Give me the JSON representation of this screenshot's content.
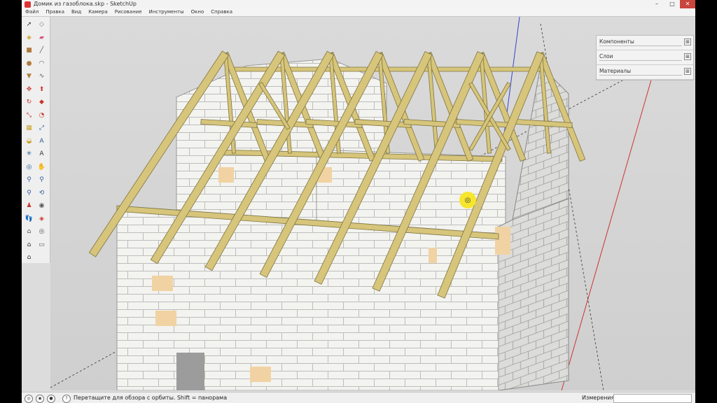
{
  "window": {
    "title": "Домик из газоблока.skp - SketchUp",
    "minimize": "–",
    "maximize": "□",
    "close": "✕"
  },
  "menu": [
    "Файл",
    "Правка",
    "Вид",
    "Камера",
    "Рисование",
    "Инструменты",
    "Окно",
    "Справка"
  ],
  "toolbar": {
    "tools": [
      {
        "name": "select-icon",
        "glyph": "➚",
        "color": "#333333"
      },
      {
        "name": "eraser-icon",
        "glyph": "◇",
        "color": "#777777"
      },
      {
        "name": "paint-bucket-icon",
        "glyph": "◈",
        "color": "#c9a227"
      },
      {
        "name": "eraser-pink-icon",
        "glyph": "▰",
        "color": "#d85a8a"
      },
      {
        "name": "rectangle-icon",
        "glyph": "■",
        "color": "#b07b3e"
      },
      {
        "name": "pencil-icon",
        "glyph": "╱",
        "color": "#555555"
      },
      {
        "name": "circle-icon",
        "glyph": "●",
        "color": "#b07b3e"
      },
      {
        "name": "arc-icon",
        "glyph": "◠",
        "color": "#555555"
      },
      {
        "name": "polygon-icon",
        "glyph": "▼",
        "color": "#b07b3e"
      },
      {
        "name": "freehand-icon",
        "glyph": "∿",
        "color": "#555555"
      },
      {
        "name": "move-icon",
        "glyph": "✥",
        "color": "#c8372d"
      },
      {
        "name": "push-pull-icon",
        "glyph": "⬆",
        "color": "#c8372d"
      },
      {
        "name": "rotate-icon",
        "glyph": "↻",
        "color": "#c8372d"
      },
      {
        "name": "follow-me-icon",
        "glyph": "◆",
        "color": "#c8372d"
      },
      {
        "name": "scale-icon",
        "glyph": "⤡",
        "color": "#c8372d"
      },
      {
        "name": "offset-icon",
        "glyph": "◔",
        "color": "#c8372d"
      },
      {
        "name": "tape-measure-icon",
        "glyph": "▦",
        "color": "#c9a227"
      },
      {
        "name": "dimension-icon",
        "glyph": "⤢",
        "color": "#2e5c99"
      },
      {
        "name": "protractor-icon",
        "glyph": "◒",
        "color": "#c9a227"
      },
      {
        "name": "text-icon",
        "glyph": "A",
        "color": "#2e5c99"
      },
      {
        "name": "axes-icon",
        "glyph": "✳",
        "color": "#2e5c99"
      },
      {
        "name": "3d-text-icon",
        "glyph": "A",
        "color": "#333333"
      },
      {
        "name": "orbit-icon",
        "glyph": "◎",
        "color": "#2e5c99"
      },
      {
        "name": "pan-icon",
        "glyph": "✋",
        "color": "#2e5c99"
      },
      {
        "name": "zoom-icon",
        "glyph": "⚲",
        "color": "#2e5c99"
      },
      {
        "name": "zoom-window-icon",
        "glyph": "⚲",
        "color": "#2e5c99"
      },
      {
        "name": "zoom-extents-icon",
        "glyph": "⚲",
        "color": "#2e5c99"
      },
      {
        "name": "previous-view-icon",
        "glyph": "⟲",
        "color": "#2e5c99"
      },
      {
        "name": "position-camera-icon",
        "glyph": "♟",
        "color": "#c8372d"
      },
      {
        "name": "look-around-icon",
        "glyph": "◉",
        "color": "#555555"
      },
      {
        "name": "walk-icon",
        "glyph": "👣",
        "color": "#333333"
      },
      {
        "name": "section-plane-icon",
        "glyph": "◈",
        "color": "#c8372d"
      },
      {
        "name": "warehouse-icon",
        "glyph": "⌂",
        "color": "#555555"
      },
      {
        "name": "share-model-icon",
        "glyph": "◎",
        "color": "#555555"
      },
      {
        "name": "house-icon",
        "glyph": "⌂",
        "color": "#333333"
      },
      {
        "name": "component-icon",
        "glyph": "▭",
        "color": "#555555"
      },
      {
        "name": "extension-icon",
        "glyph": "⌂",
        "color": "#333333"
      }
    ]
  },
  "tray": {
    "panels": [
      {
        "label": "Компоненты",
        "toggle": "⊞"
      },
      {
        "label": "Слои",
        "toggle": "⊞"
      },
      {
        "label": "Материалы",
        "toggle": "⊞"
      }
    ]
  },
  "status": {
    "hint": "Перетащите для обзора с орбиты. Shift = панорама",
    "icon1": "◎",
    "icon2": "◉",
    "icon3": "●",
    "help": "?",
    "measure_label": "Измерения",
    "measure_value": ""
  },
  "colors": {
    "block": "#f2f2ef",
    "block_shade": "#cfcfcf",
    "wood": "#d6c57a",
    "insulation": "#f1d3a3",
    "sky": "#d5d5d5"
  }
}
